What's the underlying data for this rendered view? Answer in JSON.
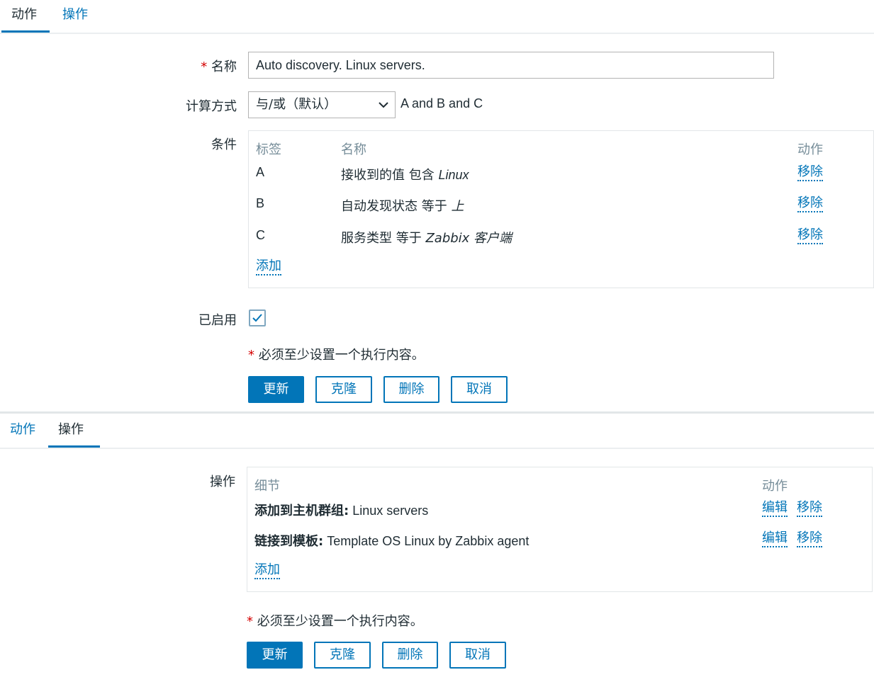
{
  "panel1": {
    "tabs": [
      "动作",
      "操作"
    ],
    "name_label": "名称",
    "name_value": "Auto discovery. Linux servers.",
    "calc_label": "计算方式",
    "calc_value": "与/或（默认）",
    "calc_expr": "A and B and C",
    "conditions_label": "条件",
    "conditions": {
      "headers": [
        "标签",
        "名称",
        "动作"
      ],
      "rows": [
        {
          "tag": "A",
          "name_prefix": "接收到的值 包含 ",
          "name_value": "Linux",
          "action": "移除"
        },
        {
          "tag": "B",
          "name_prefix": "自动发现状态 等于 ",
          "name_value": "上",
          "action": "移除"
        },
        {
          "tag": "C",
          "name_prefix": "服务类型 等于 ",
          "name_value": "Zabbix 客户端",
          "action": "移除"
        }
      ],
      "add": "添加"
    },
    "enabled_label": "已启用",
    "enabled": true,
    "note": "必须至少设置一个执行内容。",
    "buttons": {
      "update": "更新",
      "clone": "克隆",
      "delete": "删除",
      "cancel": "取消"
    }
  },
  "panel2": {
    "tabs": [
      "动作",
      "操作"
    ],
    "ops_label": "操作",
    "ops": {
      "headers": [
        "细节",
        "动作"
      ],
      "rows": [
        {
          "detail_bold": "添加到主机群组:",
          "detail_value": " Linux servers",
          "edit": "编辑",
          "remove": "移除"
        },
        {
          "detail_bold": "链接到模板:",
          "detail_value": " Template OS Linux by Zabbix agent",
          "edit": "编辑",
          "remove": "移除"
        }
      ],
      "add": "添加"
    },
    "note": "必须至少设置一个执行内容。",
    "buttons": {
      "update": "更新",
      "clone": "克隆",
      "delete": "删除",
      "cancel": "取消"
    }
  },
  "colors": {
    "accent": "#0275b8",
    "required": "#d40000",
    "header_gray": "#768d99"
  },
  "icons": [
    "chevron-down-icon",
    "checkmark-icon"
  ]
}
